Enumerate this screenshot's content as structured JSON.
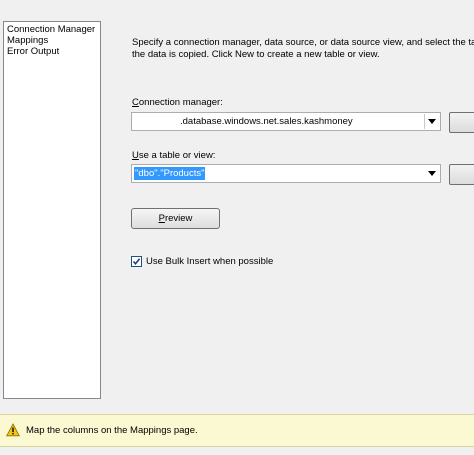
{
  "nav": {
    "items": [
      "Connection Manager",
      "Mappings",
      "Error Output"
    ]
  },
  "description": {
    "line1": "Specify a connection manager, data source, or data source view, and select the table or th",
    "line2": "the data is copied. Click New to create a new table or view."
  },
  "connection": {
    "label_mnemonic": "C",
    "label_rest": "onnection manager:",
    "value": ".database.windows.net.sales.kashmoney"
  },
  "table": {
    "label_mnemonic": "U",
    "label_rest": "se a table or view:",
    "value": "\"dbo\".\"Products\""
  },
  "preview": {
    "mnemonic": "P",
    "rest": "review"
  },
  "bulk_insert": {
    "label": "Use Bulk Insert when possible",
    "checked": true
  },
  "status": {
    "message": "Map the columns on the Mappings page."
  },
  "icons": [
    "chevron-down-icon",
    "checkmark-icon",
    "warning-icon"
  ],
  "colors": {
    "selection": "#3399ff",
    "status_background": "#fbf9d2"
  }
}
